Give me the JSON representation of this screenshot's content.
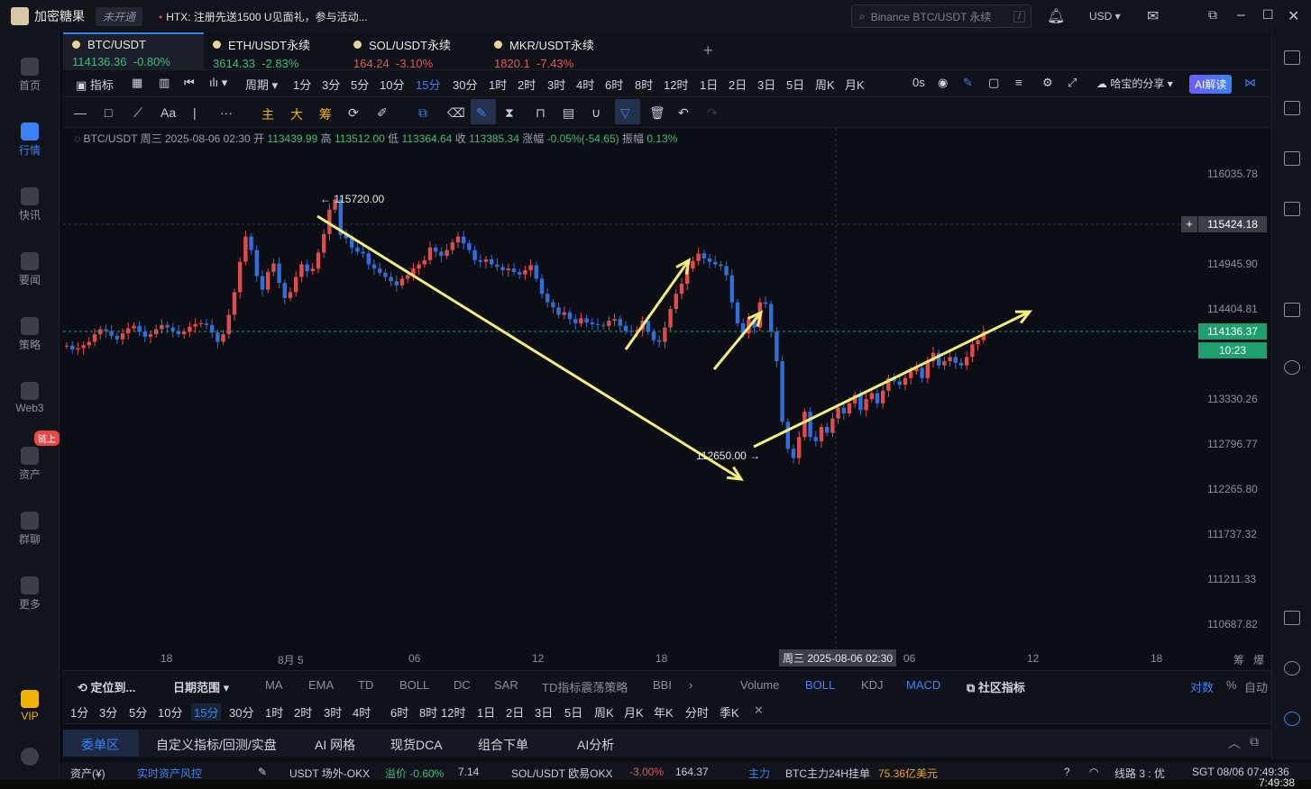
{
  "titlebar": {
    "app_name": "加密糖果",
    "badge": "未开通",
    "ticker": "HTX:  注册先送1500 U见面礼，参与活动...",
    "search_placeholder": "Binance BTC/USDT 永续",
    "currency": "USD"
  },
  "sidebar": {
    "items": [
      {
        "label": "首页",
        "icon": "home-icon"
      },
      {
        "label": "行情",
        "icon": "chart-bars-icon"
      },
      {
        "label": "快讯",
        "icon": "news-icon"
      },
      {
        "label": "要闻",
        "icon": "document-icon"
      },
      {
        "label": "策略",
        "icon": "robot-icon"
      },
      {
        "label": "Web3",
        "icon": "web3-icon"
      },
      {
        "label": "资产",
        "icon": "wallet-icon"
      },
      {
        "label": "群聊",
        "icon": "chat-icon"
      },
      {
        "label": "更多",
        "icon": "grid-icon"
      },
      {
        "label": "VIP",
        "icon": "vip-icon"
      }
    ],
    "asset_badge": "链上"
  },
  "tabs": [
    {
      "name": "BTC/USDT",
      "price": "114136.36",
      "change": "-0.80%"
    },
    {
      "name": "ETH/USDT永续",
      "price": "3614.33",
      "change": "-2.83%"
    },
    {
      "name": "SOL/USDT永续",
      "price": "164.24",
      "change": "-3.10%"
    },
    {
      "name": "MKR/USDT永续",
      "price": "1820.1",
      "change": "-7.43%"
    }
  ],
  "toolbar": {
    "indicator": "指标",
    "period": "周期",
    "timeframes": [
      "1分",
      "3分",
      "5分",
      "10分",
      "15分",
      "30分",
      "1时",
      "2时",
      "3时",
      "4时",
      "6时",
      "8时",
      "12时",
      "1日",
      "2日",
      "3日",
      "5日",
      "周K",
      "月K"
    ],
    "selected_timeframe": "15分",
    "countdown": "0s",
    "share": "哈宝的分享",
    "ai_label": "AI解读"
  },
  "drawtools": {
    "main": "主",
    "big": "大",
    "chip": "筹",
    "text_tool": "Aa"
  },
  "infoline": {
    "symbol": "BTC/USDT",
    "date": "周三 2025-08-06 02:30",
    "open_label": "开",
    "open": "113439.99",
    "high_label": "高",
    "high": "113512.00",
    "low_label": "低",
    "low": "113364.64",
    "close_label": "收",
    "close": "113385.34",
    "chg_label": "涨幅",
    "chg": "-0.05%(-54.65)",
    "amp_label": "振幅",
    "amp": "0.13%"
  },
  "yaxis": {
    "labels": [
      "116035.78",
      "114945.90",
      "114404.81",
      "113330.26",
      "112796.77",
      "112265.80",
      "111737.32",
      "111211.33",
      "110687.82"
    ],
    "crosshair_price": "115424.18",
    "last_price": "114136.37",
    "countdown": "10:23"
  },
  "xaxis": {
    "labels": [
      "18",
      "8月 5",
      "06",
      "12",
      "18",
      "06",
      "12",
      "18"
    ],
    "crosshair_time": "周三 2025-08-06 02:30",
    "right_labels": [
      "筹",
      "爆"
    ]
  },
  "chart_data": {
    "type": "candlestick",
    "symbol": "BTC/USDT",
    "interval": "15m",
    "ylim": [
      110687.82,
      116035.78
    ],
    "high_marker": "115720.00",
    "low_marker": "112650.00",
    "close_series": [
      113985,
      113940,
      113955,
      113990,
      114030,
      114120,
      114180,
      114160,
      114100,
      114060,
      114130,
      114190,
      114220,
      114150,
      114090,
      114120,
      114180,
      114230,
      114200,
      114160,
      114120,
      114150,
      114210,
      114240,
      114250,
      114230,
      114140,
      114030,
      114120,
      114350,
      114620,
      114980,
      115280,
      115120,
      114810,
      114650,
      114860,
      114960,
      114730,
      114550,
      114620,
      114800,
      114950,
      114870,
      114900,
      115090,
      115310,
      115600,
      115720,
      115300,
      115260,
      115150,
      115100,
      115080,
      114950,
      114900,
      114850,
      114800,
      114750,
      114700,
      114780,
      114820,
      114900,
      114950,
      115000,
      115150,
      115100,
      115050,
      115120,
      115210,
      115280,
      115200,
      115120,
      115000,
      114980,
      115010,
      114950,
      114920,
      114880,
      114900,
      114860,
      114830,
      114880,
      114940,
      114780,
      114600,
      114500,
      114440,
      114350,
      114380,
      114300,
      114250,
      114310,
      114260,
      114240,
      114230,
      114220,
      114280,
      114300,
      114220,
      114160,
      114150,
      114170,
      114280,
      114150,
      114050,
      114030,
      114200,
      114420,
      114600,
      114720,
      114900,
      114990,
      115080,
      115020,
      114980,
      114950,
      114930,
      114820,
      114500,
      114250,
      114130,
      114300,
      114200,
      114500,
      114480,
      114150,
      113800,
      113080,
      112760,
      112650,
      112900,
      113200,
      112900,
      112850,
      113020,
      112950,
      113120,
      113250,
      113180,
      113300,
      113400,
      113220,
      113350,
      113420,
      113300,
      113450,
      113600,
      113560,
      113520,
      113600,
      113680,
      113720,
      113600,
      113800,
      113900,
      113750,
      113800,
      113850,
      113780,
      113750,
      113850,
      114000,
      114050,
      114150
    ]
  },
  "indbar": {
    "locate": "定位到...",
    "date_range": "日期范围",
    "indicators": [
      "MA",
      "EMA",
      "TD",
      "BOLL",
      "DC",
      "SAR",
      "TD指标震荡策略",
      "BBI"
    ],
    "sub_indicators": [
      "Volume",
      "BOLL",
      "KDJ",
      "MACD"
    ],
    "community": "社区指标",
    "right": [
      "对数",
      "%",
      "自动"
    ]
  },
  "tfbar2": {
    "items": [
      "1分",
      "3分",
      "5分",
      "10分",
      "15分",
      "30分",
      "1时",
      "2时",
      "3时",
      "4时",
      "6时",
      "8时",
      "12时",
      "1日",
      "2日",
      "3日",
      "5日",
      "周K",
      "月K",
      "年K",
      "分时",
      "季K"
    ],
    "selected": "15分"
  },
  "bottomtabs": [
    "委单区",
    "自定义指标/回测/实盘",
    "AI 网格",
    "现货DCA",
    "组合下单",
    "AI分析"
  ],
  "statusbar": {
    "asset": "资产(¥)",
    "risk": "实时资产风控",
    "otc": "USDT 场外-OKX",
    "otc_premium": "溢价 -0.60%",
    "otc_price": "7.14",
    "sol": "SOL/USDT 欧易OKX",
    "sol_chg": "-3.00%",
    "sol_price": "164.37",
    "main_force": "主力",
    "btc_main": "BTC主力24H挂单",
    "btc_amount": "75.36亿美元",
    "line": "线路 3 : 优",
    "sgt": "SGT 08/06 07:49:36",
    "clock": "7:49:38"
  }
}
